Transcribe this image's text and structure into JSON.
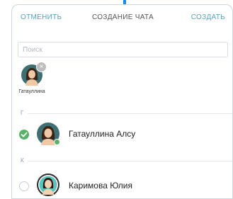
{
  "header": {
    "cancel_label": "ОТМЕНИТЬ",
    "title": "СОЗДАНИЕ ЧАТА",
    "create_label": "СОЗДАТЬ"
  },
  "search": {
    "placeholder": "Поиск"
  },
  "selected": [
    {
      "label": "Гатауллина",
      "remove_icon": "close-icon"
    }
  ],
  "sections": [
    {
      "letter": "Г",
      "contacts": [
        {
          "name": "Гатауллина Алсу",
          "selected": true,
          "online": true
        }
      ]
    },
    {
      "letter": "К",
      "contacts": [
        {
          "name": "Каримова Юлия",
          "selected": false,
          "online": false
        }
      ]
    }
  ],
  "colors": {
    "accent": "#5aa0b8",
    "check": "#58b368",
    "top_bar": "#1e88e5"
  }
}
